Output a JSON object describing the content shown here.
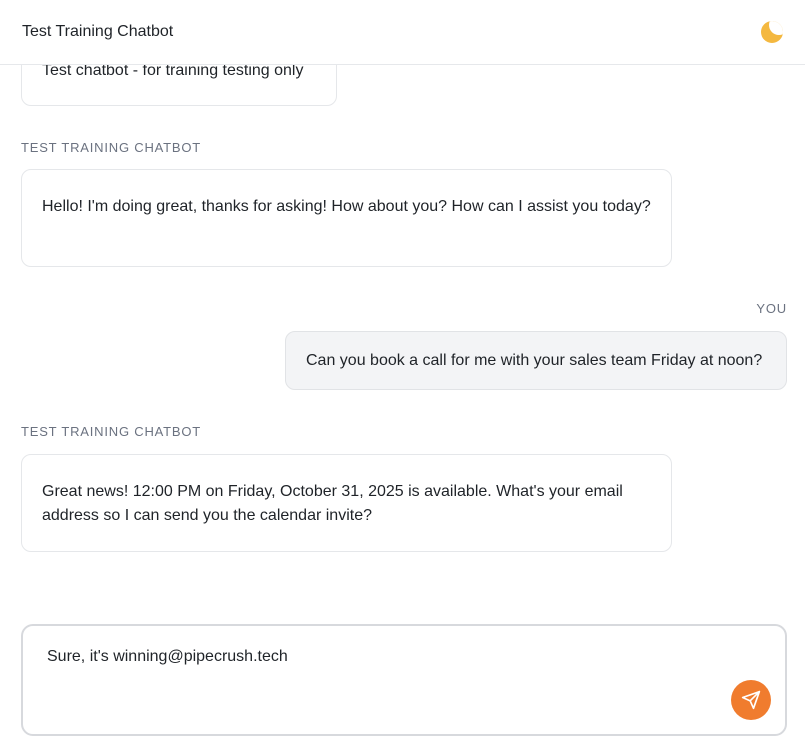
{
  "header": {
    "title": "Test Training Chatbot",
    "theme_icon": "moon-icon"
  },
  "messages": [
    {
      "sender": "",
      "role": "bot",
      "text": "Test chatbot - for training testing only"
    },
    {
      "sender": "TEST TRAINING CHATBOT",
      "role": "bot",
      "text": "Hello! I'm doing great, thanks for asking! How about you? How can I assist you today?"
    },
    {
      "sender": "YOU",
      "role": "user",
      "text": "Can you book a call for me with your sales team Friday at noon?"
    },
    {
      "sender": "TEST TRAINING CHATBOT",
      "role": "bot",
      "text": "Great news! 12:00 PM on Friday, October 31, 2025 is available. What's your email address so I can send you the calendar invite?"
    }
  ],
  "composer": {
    "value": "Sure, it's winning@pipecrush.tech",
    "send_icon": "send-icon"
  },
  "colors": {
    "accent": "#f07c2e",
    "user_bubble": "#f3f4f6",
    "border": "#e5e7ea"
  }
}
